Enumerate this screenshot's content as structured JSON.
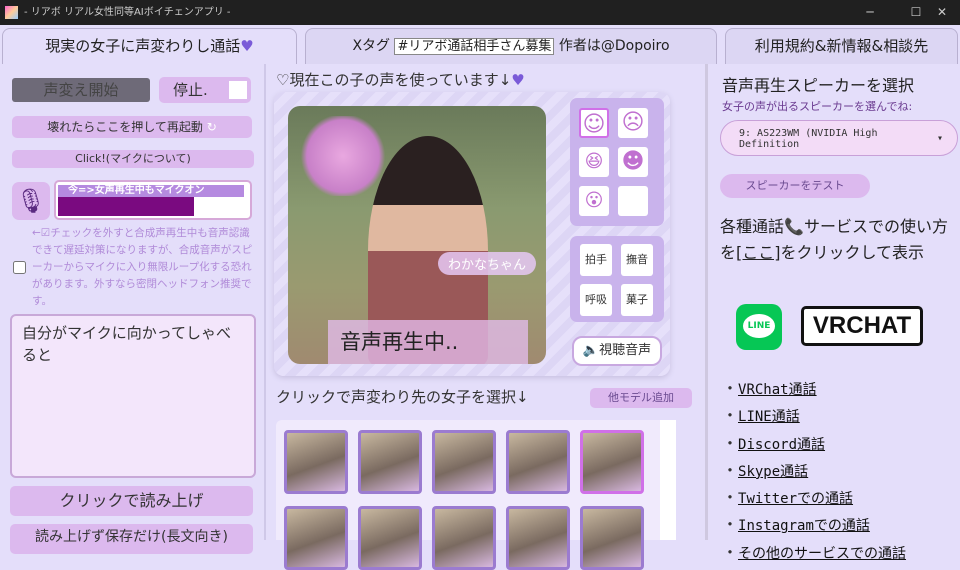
{
  "window": {
    "title": "- リアボ リアル女性同等AIボイチェンアプリ -",
    "min": "─",
    "max": "☐",
    "close": "✕"
  },
  "tabs": [
    {
      "label": "現実の女子に声変わりし通話"
    },
    {
      "label_prefix": "Xタグ",
      "tag_value": "#リアボ通話相手さん募集",
      "author": "作者は@Dopoiro"
    },
    {
      "label": "利用規約&新情報&相談先"
    }
  ],
  "left": {
    "start_label": "声変え開始",
    "stop_label": "停止.",
    "restart_label": "壊れたらここを押して再起動",
    "mic_info_label": "Click!(マイクについて)",
    "mic_status": "今=>女声再生中もマイクオン",
    "mic_level": 0.7,
    "note": "←☑チェックを外すと合成声再生中も音声認識できて遅延対策になりますが、合成音声がスピーカーからマイクに入り無限ループ化する恐れがあります。外すなら密閉ヘッドフォン推奨です。",
    "textarea_value": "自分がマイクに向かってしゃべると",
    "read_label": "クリックで読み上げ",
    "save_label": "読み上げず保存だけ(長文向き)"
  },
  "center": {
    "heading": "現在この子の声を使っています↓",
    "char_name": "わかなちゃん",
    "playing": "音声再生中..",
    "faces": [
      "☺",
      "☹",
      "😆",
      "☻",
      "😮",
      ""
    ],
    "sfx": [
      "拍手",
      "撫音",
      "呼吸",
      "菓子"
    ],
    "preview_label": "視聴音声",
    "select_heading": "クリックで声変わり先の女子を選択↓",
    "add_model_label": "他モデル追加"
  },
  "right": {
    "heading": "音声再生スピーカーを選択",
    "sub": "女子の声が出るスピーカーを選んでね:",
    "speaker_value": "9: AS223WM (NVIDIA High Definition",
    "test_label": "スピーカーをテスト",
    "howto_pre": "各種通話",
    "howto_mid": "サービスでの使い方を",
    "howto_link": "[ここ]",
    "howto_post": "をクリックして表示",
    "line_logo": "LINE",
    "vrchat_logo": "VRCHAT",
    "links": [
      "VRChat通話",
      "LINE通話",
      "Discord通話",
      "Skype通話",
      "Twitterでの通話",
      "Instagramでの通話",
      "その他のサービスでの通話"
    ]
  }
}
